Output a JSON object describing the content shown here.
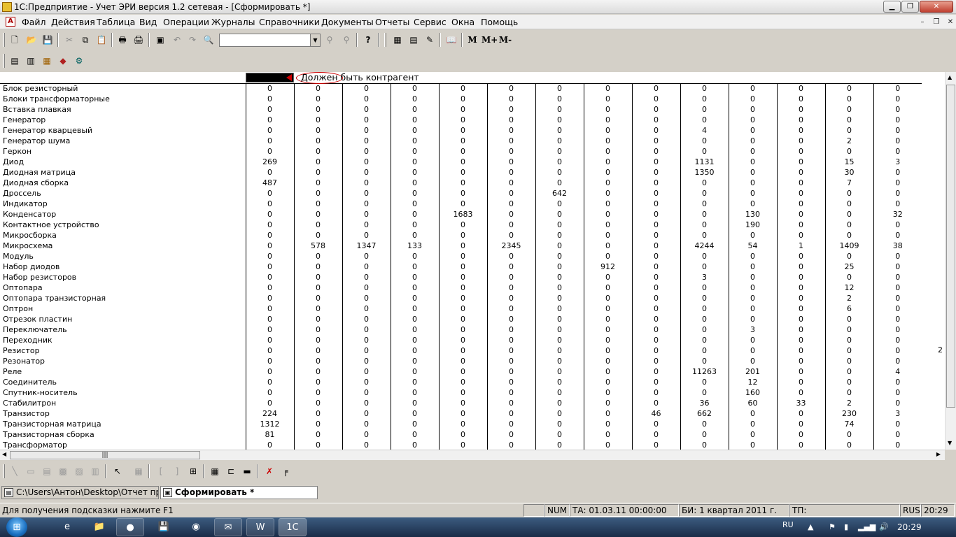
{
  "window": {
    "title": "1С:Предприятие - Учет ЭРИ версия 1.2 сетевая - [Сформировать  *]"
  },
  "menu": [
    "Файл",
    "Действия",
    "Таблица",
    "Вид",
    "Операции",
    "Журналы",
    "Справочники",
    "Документы",
    "Отчеты",
    "Сервис",
    "Окна",
    "Помощь"
  ],
  "toolbar": {
    "memory_buttons": [
      "M",
      "M+",
      "M-"
    ],
    "search_value": ""
  },
  "sheet": {
    "header_text": "Должен быть контрагент",
    "rows": [
      {
        "name": "Блок резисторный",
        "values": [
          "0",
          "0",
          "0",
          "0",
          "0",
          "0",
          "0",
          "0",
          "0",
          "0",
          "0",
          "0",
          "0",
          "0"
        ]
      },
      {
        "name": "Блоки трансформаторные",
        "values": [
          "0",
          "0",
          "0",
          "0",
          "0",
          "0",
          "0",
          "0",
          "0",
          "0",
          "0",
          "0",
          "0",
          "0"
        ]
      },
      {
        "name": "Вставка плавкая",
        "values": [
          "0",
          "0",
          "0",
          "0",
          "0",
          "0",
          "0",
          "0",
          "0",
          "0",
          "0",
          "0",
          "0",
          "0"
        ]
      },
      {
        "name": "Генератор",
        "values": [
          "0",
          "0",
          "0",
          "0",
          "0",
          "0",
          "0",
          "0",
          "0",
          "0",
          "0",
          "0",
          "0",
          "0"
        ]
      },
      {
        "name": "Генератор кварцевый",
        "values": [
          "0",
          "0",
          "0",
          "0",
          "0",
          "0",
          "0",
          "0",
          "0",
          "4",
          "0",
          "0",
          "0",
          "0"
        ]
      },
      {
        "name": "Генератор шума",
        "values": [
          "0",
          "0",
          "0",
          "0",
          "0",
          "0",
          "0",
          "0",
          "0",
          "0",
          "0",
          "0",
          "2",
          "0"
        ]
      },
      {
        "name": "Геркон",
        "values": [
          "0",
          "0",
          "0",
          "0",
          "0",
          "0",
          "0",
          "0",
          "0",
          "0",
          "0",
          "0",
          "0",
          "0"
        ]
      },
      {
        "name": "Диод",
        "values": [
          "269",
          "0",
          "0",
          "0",
          "0",
          "0",
          "0",
          "0",
          "0",
          "1131",
          "0",
          "0",
          "15",
          "3"
        ]
      },
      {
        "name": "Диодная матрица",
        "values": [
          "0",
          "0",
          "0",
          "0",
          "0",
          "0",
          "0",
          "0",
          "0",
          "1350",
          "0",
          "0",
          "30",
          "0"
        ]
      },
      {
        "name": "Диодная сборка",
        "values": [
          "487",
          "0",
          "0",
          "0",
          "0",
          "0",
          "0",
          "0",
          "0",
          "0",
          "0",
          "0",
          "7",
          "0"
        ]
      },
      {
        "name": "Дроссель",
        "values": [
          "0",
          "0",
          "0",
          "0",
          "0",
          "0",
          "642",
          "0",
          "0",
          "0",
          "0",
          "0",
          "0",
          "0"
        ]
      },
      {
        "name": "Индикатор",
        "values": [
          "0",
          "0",
          "0",
          "0",
          "0",
          "0",
          "0",
          "0",
          "0",
          "0",
          "0",
          "0",
          "0",
          "0"
        ]
      },
      {
        "name": "Конденсатор",
        "values": [
          "0",
          "0",
          "0",
          "0",
          "1683",
          "0",
          "0",
          "0",
          "0",
          "0",
          "130",
          "0",
          "0",
          "32"
        ]
      },
      {
        "name": "Контактное устройство",
        "values": [
          "0",
          "0",
          "0",
          "0",
          "0",
          "0",
          "0",
          "0",
          "0",
          "0",
          "190",
          "0",
          "0",
          "0"
        ]
      },
      {
        "name": "Микросборка",
        "values": [
          "0",
          "0",
          "0",
          "0",
          "0",
          "0",
          "0",
          "0",
          "0",
          "0",
          "0",
          "0",
          "0",
          "0"
        ]
      },
      {
        "name": "Микросхема",
        "values": [
          "0",
          "578",
          "1347",
          "133",
          "0",
          "2345",
          "0",
          "0",
          "0",
          "4244",
          "54",
          "1",
          "1409",
          "38"
        ]
      },
      {
        "name": "Модуль",
        "values": [
          "0",
          "0",
          "0",
          "0",
          "0",
          "0",
          "0",
          "0",
          "0",
          "0",
          "0",
          "0",
          "0",
          "0"
        ]
      },
      {
        "name": "Набор диодов",
        "values": [
          "0",
          "0",
          "0",
          "0",
          "0",
          "0",
          "0",
          "912",
          "0",
          "0",
          "0",
          "0",
          "25",
          "0"
        ]
      },
      {
        "name": "Набор резисторов",
        "values": [
          "0",
          "0",
          "0",
          "0",
          "0",
          "0",
          "0",
          "0",
          "0",
          "3",
          "0",
          "0",
          "0",
          "0"
        ]
      },
      {
        "name": "Оптопара",
        "values": [
          "0",
          "0",
          "0",
          "0",
          "0",
          "0",
          "0",
          "0",
          "0",
          "0",
          "0",
          "0",
          "12",
          "0"
        ]
      },
      {
        "name": "Оптопара транзисторная",
        "values": [
          "0",
          "0",
          "0",
          "0",
          "0",
          "0",
          "0",
          "0",
          "0",
          "0",
          "0",
          "0",
          "2",
          "0"
        ]
      },
      {
        "name": "Оптрон",
        "values": [
          "0",
          "0",
          "0",
          "0",
          "0",
          "0",
          "0",
          "0",
          "0",
          "0",
          "0",
          "0",
          "6",
          "0"
        ]
      },
      {
        "name": "Отрезок пластин",
        "values": [
          "0",
          "0",
          "0",
          "0",
          "0",
          "0",
          "0",
          "0",
          "0",
          "0",
          "0",
          "0",
          "0",
          "0"
        ]
      },
      {
        "name": "Переключатель",
        "values": [
          "0",
          "0",
          "0",
          "0",
          "0",
          "0",
          "0",
          "0",
          "0",
          "0",
          "3",
          "0",
          "0",
          "0"
        ]
      },
      {
        "name": "Переходник",
        "values": [
          "0",
          "0",
          "0",
          "0",
          "0",
          "0",
          "0",
          "0",
          "0",
          "0",
          "0",
          "0",
          "0",
          "0"
        ]
      },
      {
        "name": "Резистор",
        "values": [
          "0",
          "0",
          "0",
          "0",
          "0",
          "0",
          "0",
          "0",
          "0",
          "0",
          "0",
          "0",
          "0",
          "0"
        ],
        "overflow": "2"
      },
      {
        "name": "Резонатор",
        "values": [
          "0",
          "0",
          "0",
          "0",
          "0",
          "0",
          "0",
          "0",
          "0",
          "0",
          "0",
          "0",
          "0",
          "0"
        ]
      },
      {
        "name": "Реле",
        "values": [
          "0",
          "0",
          "0",
          "0",
          "0",
          "0",
          "0",
          "0",
          "0",
          "11263",
          "201",
          "0",
          "0",
          "4"
        ]
      },
      {
        "name": "Соединитель",
        "values": [
          "0",
          "0",
          "0",
          "0",
          "0",
          "0",
          "0",
          "0",
          "0",
          "0",
          "12",
          "0",
          "0",
          "0"
        ]
      },
      {
        "name": "Спутник-носитель",
        "values": [
          "0",
          "0",
          "0",
          "0",
          "0",
          "0",
          "0",
          "0",
          "0",
          "0",
          "160",
          "0",
          "0",
          "0"
        ]
      },
      {
        "name": "Стабилитрон",
        "values": [
          "0",
          "0",
          "0",
          "0",
          "0",
          "0",
          "0",
          "0",
          "0",
          "36",
          "60",
          "33",
          "2",
          "0"
        ]
      },
      {
        "name": "Транзистор",
        "values": [
          "224",
          "0",
          "0",
          "0",
          "0",
          "0",
          "0",
          "0",
          "46",
          "662",
          "0",
          "0",
          "230",
          "3"
        ]
      },
      {
        "name": "Транзисторная матрица",
        "values": [
          "1312",
          "0",
          "0",
          "0",
          "0",
          "0",
          "0",
          "0",
          "0",
          "0",
          "0",
          "0",
          "74",
          "0"
        ]
      },
      {
        "name": "Транзисторная сборка",
        "values": [
          "81",
          "0",
          "0",
          "0",
          "0",
          "0",
          "0",
          "0",
          "0",
          "0",
          "0",
          "0",
          "0",
          "0"
        ]
      },
      {
        "name": "Трансформатор",
        "values": [
          "0",
          "0",
          "0",
          "0",
          "0",
          "0",
          "0",
          "0",
          "0",
          "0",
          "0",
          "0",
          "0",
          "0"
        ]
      }
    ]
  },
  "windows_bar": [
    {
      "label": "C:\\Users\\Антон\\Desktop\\Отчет при...",
      "active": false
    },
    {
      "label": "Сформировать  *",
      "active": true
    }
  ],
  "status": {
    "hint": "Для получения подсказки нажмите F1",
    "num": "NUM",
    "ta": "ТА: 01.03.11  00:00:00",
    "bi": "БИ: 1 квартал 2011 г.",
    "tp": "ТП:",
    "lang": "RUS",
    "time": "20:29"
  },
  "taskbar": {
    "lang": "RU",
    "clock": "20:29"
  }
}
